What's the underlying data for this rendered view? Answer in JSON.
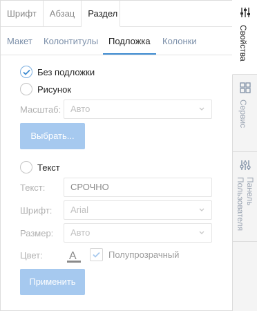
{
  "top_tabs": [
    {
      "label": "Шрифт"
    },
    {
      "label": "Абзац"
    },
    {
      "label": "Раздел"
    }
  ],
  "sub_tabs": [
    {
      "label": "Макет"
    },
    {
      "label": "Колонтитулы"
    },
    {
      "label": "Подложка"
    },
    {
      "label": "Колонки"
    }
  ],
  "watermark": {
    "none_label": "Без подложки",
    "picture_label": "Рисунок",
    "scale_label": "Масштаб:",
    "scale_value": "Авто",
    "choose_button": "Выбрать...",
    "text_label": "Текст",
    "text_field_label": "Текст:",
    "text_value": "СРОЧНО",
    "font_label": "Шрифт:",
    "font_value": "Arial",
    "size_label": "Размер:",
    "size_value": "Авто",
    "color_label": "Цвет:",
    "semi_transparent_label": "Полупрозрачный",
    "apply_button": "Применить",
    "selected_option": "none"
  },
  "side_panel": [
    {
      "label": "Свойства",
      "icon": "sliders-icon",
      "active": true
    },
    {
      "label": "Сервис",
      "icon": "grid-icon",
      "active": false
    },
    {
      "label": "Панель Пользователя",
      "icon": "tools-icon",
      "active": false
    }
  ],
  "colors": {
    "accent": "#3d8bd1",
    "button_disabled": "#a6c9ef"
  }
}
